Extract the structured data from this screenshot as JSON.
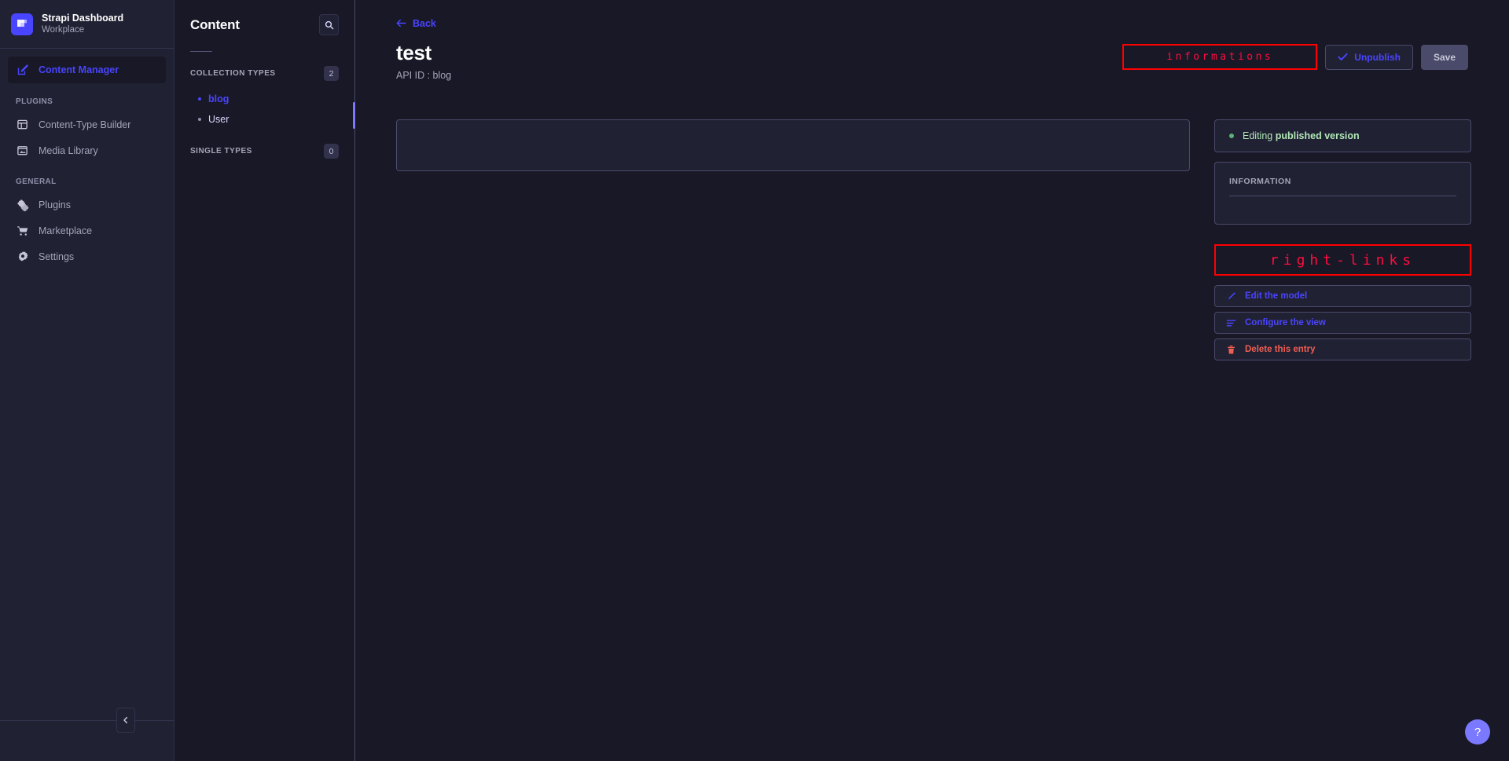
{
  "brand": {
    "title": "Strapi Dashboard",
    "subtitle": "Workplace",
    "logo_icon": "strapi-logo-icon",
    "accent": "#4945ff"
  },
  "leftnav": {
    "primary": [
      {
        "label": "Content Manager",
        "icon": "pen-square-icon",
        "active": true
      }
    ],
    "sections": [
      {
        "label": "PLUGINS",
        "items": [
          {
            "label": "Content-Type Builder",
            "icon": "layout-icon"
          },
          {
            "label": "Media Library",
            "icon": "image-icon"
          }
        ]
      },
      {
        "label": "GENERAL",
        "items": [
          {
            "label": "Plugins",
            "icon": "puzzle-icon"
          },
          {
            "label": "Marketplace",
            "icon": "shopping-cart-icon"
          },
          {
            "label": "Settings",
            "icon": "gear-icon"
          }
        ]
      }
    ],
    "collapse_icon": "chevron-left-icon"
  },
  "content_panel": {
    "title": "Content",
    "search_icon": "search-icon",
    "groups": [
      {
        "label": "COLLECTION TYPES",
        "count": "2",
        "items": [
          {
            "label": "blog",
            "active": true
          },
          {
            "label": "User",
            "active": false
          }
        ]
      },
      {
        "label": "SINGLE TYPES",
        "count": "0",
        "items": []
      }
    ]
  },
  "main": {
    "back_label": "Back",
    "back_icon": "arrow-left-icon",
    "title": "test",
    "subtitle": "API ID : blog",
    "annotation_informations": "informations",
    "unpublish_label": "Unpublish",
    "unpublish_icon": "check-icon",
    "save_label": "Save"
  },
  "right_column": {
    "status_prefix": "Editing ",
    "status_strong": "published version",
    "status_dot_color": "#5cb176",
    "information_label": "INFORMATION",
    "annotation_rightlinks": "right-links",
    "links": [
      {
        "label": "Edit the model",
        "icon": "pencil-icon",
        "danger": false
      },
      {
        "label": "Configure the view",
        "icon": "sliders-icon",
        "danger": false
      },
      {
        "label": "Delete this entry",
        "icon": "trash-icon",
        "danger": true
      }
    ]
  },
  "help": {
    "label": "?",
    "icon": "question-mark-icon"
  },
  "annotation_color": "#ff0000"
}
